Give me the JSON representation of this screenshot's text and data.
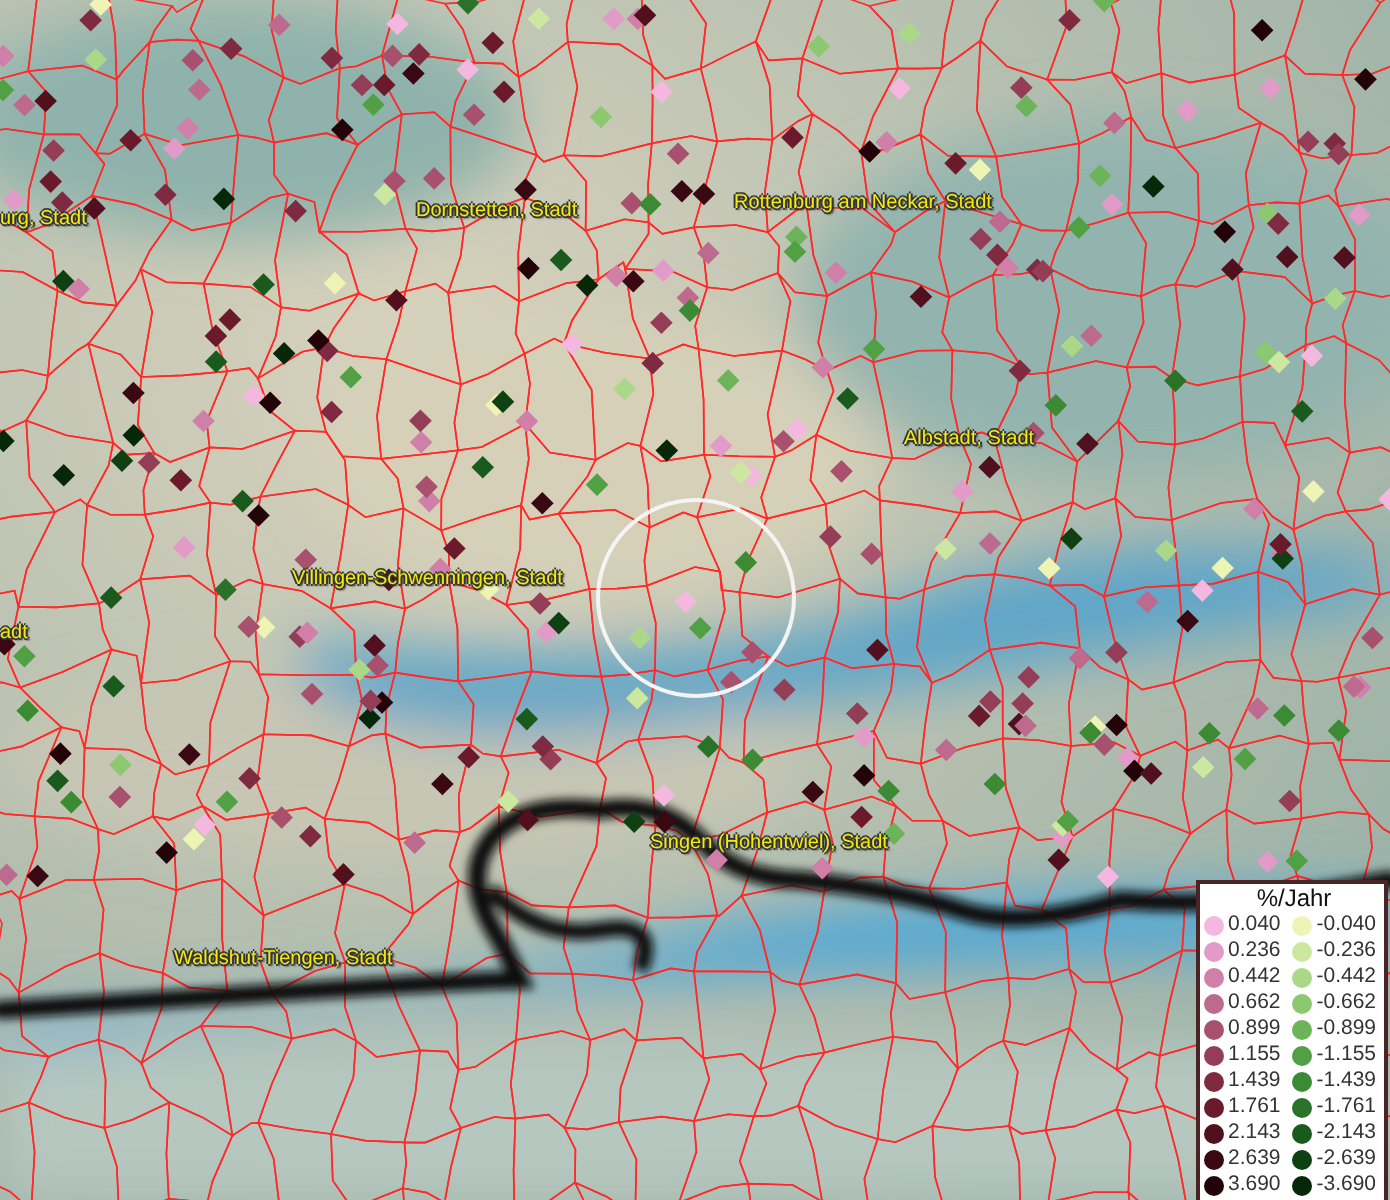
{
  "map": {
    "labels": [
      {
        "text": "urg, Stadt"
      },
      {
        "text": "Dornstetten, Stadt"
      },
      {
        "text": "Rottenburg am Neckar, Stadt"
      },
      {
        "text": "Albstadt, Stadt"
      },
      {
        "text": "Villingen-Schwenningen, Stadt"
      },
      {
        "text": "adt"
      },
      {
        "text": "Singen (Hohentwiel), Stadt"
      },
      {
        "text": "Waldshut-Tiengen, Stadt"
      }
    ]
  },
  "legend": {
    "title": "%/Jahr",
    "rows": [
      {
        "positive": {
          "value": "0.040",
          "color": "#f4b8e0"
        },
        "negative": {
          "value": "-0.040",
          "color": "#eef5b4"
        }
      },
      {
        "positive": {
          "value": "0.236",
          "color": "#e29ac8"
        },
        "negative": {
          "value": "-0.236",
          "color": "#cce7a0"
        }
      },
      {
        "positive": {
          "value": "0.442",
          "color": "#cf7fa8"
        },
        "negative": {
          "value": "-0.442",
          "color": "#abd888"
        }
      },
      {
        "positive": {
          "value": "0.662",
          "color": "#bd6a8e"
        },
        "negative": {
          "value": "-0.662",
          "color": "#8cc870"
        }
      },
      {
        "positive": {
          "value": "0.899",
          "color": "#a8506e"
        },
        "negative": {
          "value": "-0.899",
          "color": "#6db35a"
        }
      },
      {
        "positive": {
          "value": "1.155",
          "color": "#943d56"
        },
        "negative": {
          "value": "-1.155",
          "color": "#52a044"
        }
      },
      {
        "positive": {
          "value": "1.439",
          "color": "#7f2a40"
        },
        "negative": {
          "value": "-1.439",
          "color": "#3c8a34"
        }
      },
      {
        "positive": {
          "value": "1.761",
          "color": "#6b1a2c"
        },
        "negative": {
          "value": "-1.761",
          "color": "#2a7228"
        }
      },
      {
        "positive": {
          "value": "2.143",
          "color": "#52101e"
        },
        "negative": {
          "value": "-2.143",
          "color": "#1a5a1c"
        }
      },
      {
        "positive": {
          "value": "2.639",
          "color": "#3a0812"
        },
        "negative": {
          "value": "-2.639",
          "color": "#0f4012"
        }
      },
      {
        "positive": {
          "value": "3.690",
          "color": "#220308"
        },
        "negative": {
          "value": "-3.690",
          "color": "#062808"
        }
      }
    ]
  }
}
